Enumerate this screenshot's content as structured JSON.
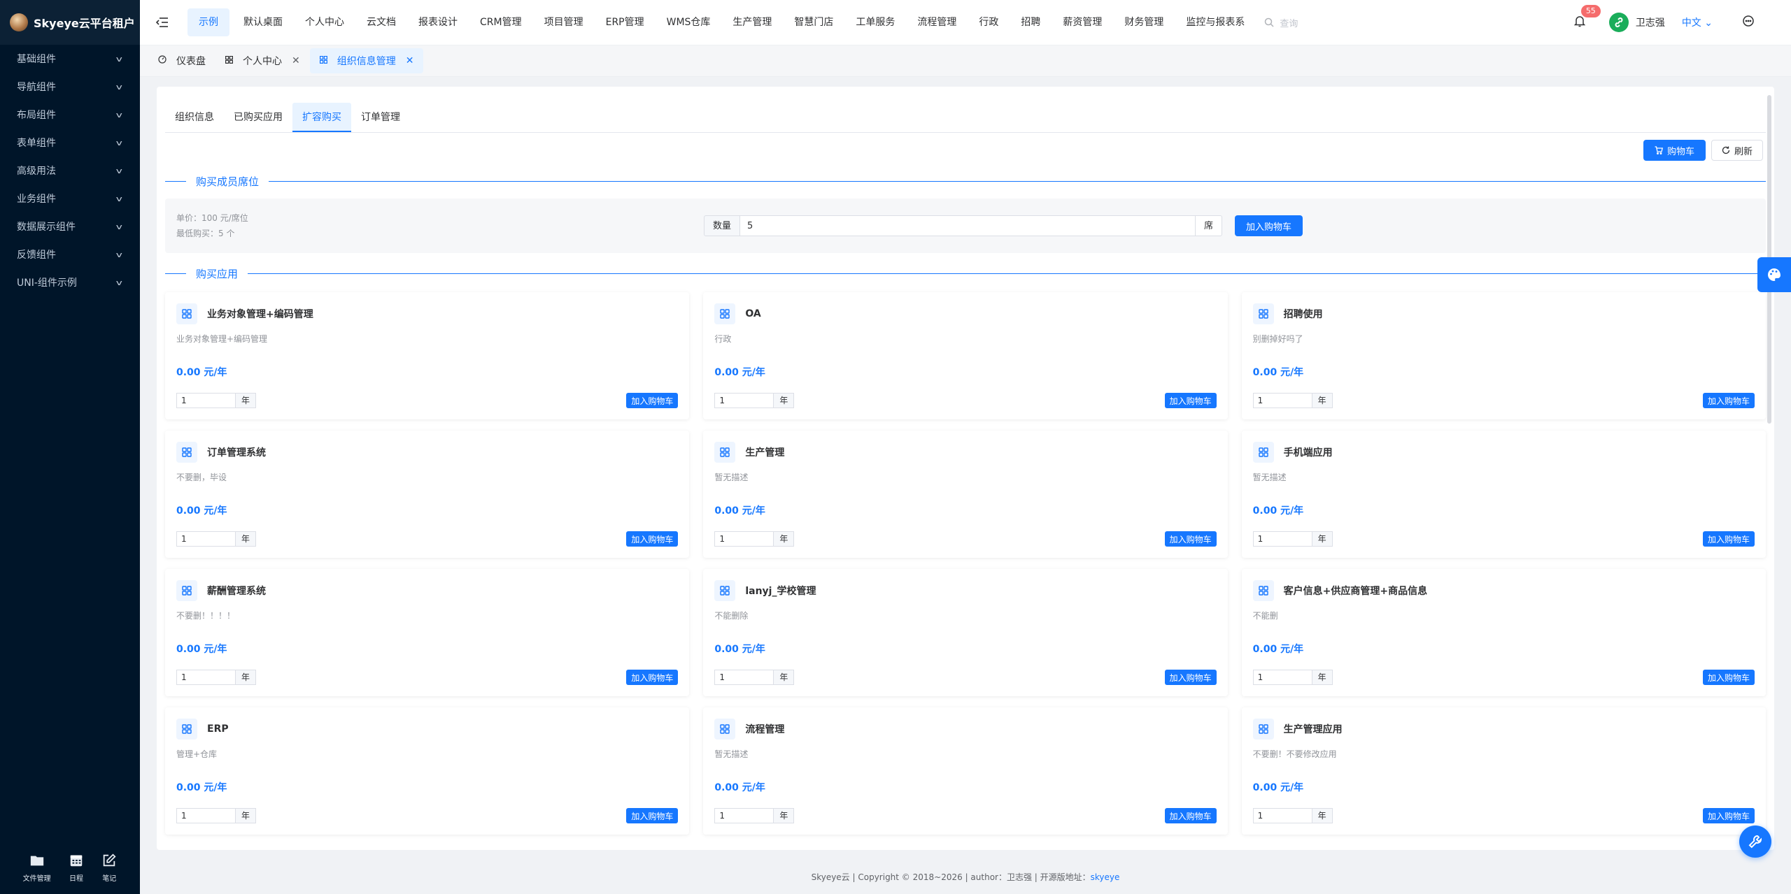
{
  "sidebar": {
    "brand": "Skyeye云平台租户",
    "items": [
      {
        "label": "基础组件"
      },
      {
        "label": "导航组件"
      },
      {
        "label": "布局组件"
      },
      {
        "label": "表单组件"
      },
      {
        "label": "高级用法"
      },
      {
        "label": "业务组件"
      },
      {
        "label": "数据展示组件"
      },
      {
        "label": "反馈组件"
      },
      {
        "label": "UNI-组件示例"
      }
    ],
    "bottom": [
      {
        "label": "文件管理",
        "icon": "folder-icon"
      },
      {
        "label": "日程",
        "icon": "calendar-icon"
      },
      {
        "label": "笔记",
        "icon": "note-icon"
      }
    ]
  },
  "header": {
    "nav": [
      {
        "label": "示例",
        "active": true
      },
      {
        "label": "默认桌面"
      },
      {
        "label": "个人中心"
      },
      {
        "label": "云文档"
      },
      {
        "label": "报表设计"
      },
      {
        "label": "CRM管理"
      },
      {
        "label": "项目管理"
      },
      {
        "label": "ERP管理"
      },
      {
        "label": "WMS仓库"
      },
      {
        "label": "生产管理"
      },
      {
        "label": "智慧门店"
      },
      {
        "label": "工单服务"
      },
      {
        "label": "流程管理"
      },
      {
        "label": "行政"
      },
      {
        "label": "招聘"
      },
      {
        "label": "薪资管理"
      },
      {
        "label": "财务管理"
      },
      {
        "label": "监控与报表系"
      }
    ],
    "search_placeholder": "查询",
    "notification_count": "55",
    "user_name": "卫志强",
    "language": "中文"
  },
  "tabs": [
    {
      "label": "仪表盘",
      "icon": "dashboard-icon"
    },
    {
      "label": "个人中心",
      "icon": "grid-icon",
      "closable": true
    },
    {
      "label": "组织信息管理",
      "icon": "grid-icon",
      "closable": true,
      "active": true
    }
  ],
  "subtabs": [
    {
      "label": "组织信息"
    },
    {
      "label": "已购买应用"
    },
    {
      "label": "扩容购买",
      "active": true
    },
    {
      "label": "订单管理"
    }
  ],
  "toolbar": {
    "cart_label": "购物车",
    "refresh_label": "刷新"
  },
  "seat_section": {
    "title": "购买成员席位",
    "unit_price": "单价：100 元/席位",
    "min_purchase": "最低购买：5 个",
    "qty_label": "数量",
    "qty_value": "5",
    "qty_suffix": "席",
    "add_label": "加入购物车"
  },
  "app_section": {
    "title": "购买应用",
    "cards": [
      {
        "title": "业务对象管理+编码管理",
        "desc": "业务对象管理+编码管理",
        "price": "0.00 元/年",
        "qty": "1",
        "unit": "年",
        "btn": "加入购物车"
      },
      {
        "title": "OA",
        "desc": "行政",
        "price": "0.00 元/年",
        "qty": "1",
        "unit": "年",
        "btn": "加入购物车"
      },
      {
        "title": "招聘使用",
        "desc": "别删掉好吗了",
        "price": "0.00 元/年",
        "qty": "1",
        "unit": "年",
        "btn": "加入购物车"
      },
      {
        "title": "订单管理系统",
        "desc": "不要删，毕设",
        "price": "0.00 元/年",
        "qty": "1",
        "unit": "年",
        "btn": "加入购物车"
      },
      {
        "title": "生产管理",
        "desc": "暂无描述",
        "price": "0.00 元/年",
        "qty": "1",
        "unit": "年",
        "btn": "加入购物车"
      },
      {
        "title": "手机端应用",
        "desc": "暂无描述",
        "price": "0.00 元/年",
        "qty": "1",
        "unit": "年",
        "btn": "加入购物车"
      },
      {
        "title": "薪酬管理系统",
        "desc": "不要删！！！！",
        "price": "0.00 元/年",
        "qty": "1",
        "unit": "年",
        "btn": "加入购物车"
      },
      {
        "title": "lanyj_学校管理",
        "desc": "不能删除",
        "price": "0.00 元/年",
        "qty": "1",
        "unit": "年",
        "btn": "加入购物车"
      },
      {
        "title": "客户信息+供应商管理+商品信息",
        "desc": "不能删",
        "price": "0.00 元/年",
        "qty": "1",
        "unit": "年",
        "btn": "加入购物车"
      },
      {
        "title": "ERP",
        "desc": "管理+仓库",
        "price": "0.00 元/年",
        "qty": "1",
        "unit": "年",
        "btn": "加入购物车"
      },
      {
        "title": "流程管理",
        "desc": "暂无描述",
        "price": "0.00 元/年",
        "qty": "1",
        "unit": "年",
        "btn": "加入购物车"
      },
      {
        "title": "生产管理应用",
        "desc": "不要删！不要修改应用",
        "price": "0.00 元/年",
        "qty": "1",
        "unit": "年",
        "btn": "加入购物车"
      }
    ]
  },
  "footer": {
    "text": "Skyeye云 | Copyright © 2018~2026 | author：卫志强 | 开源版地址：",
    "link": "skyeye"
  },
  "colors": {
    "primary": "#1677ff",
    "sidebar_bg": "#001529",
    "badge": "#f56c6c"
  }
}
